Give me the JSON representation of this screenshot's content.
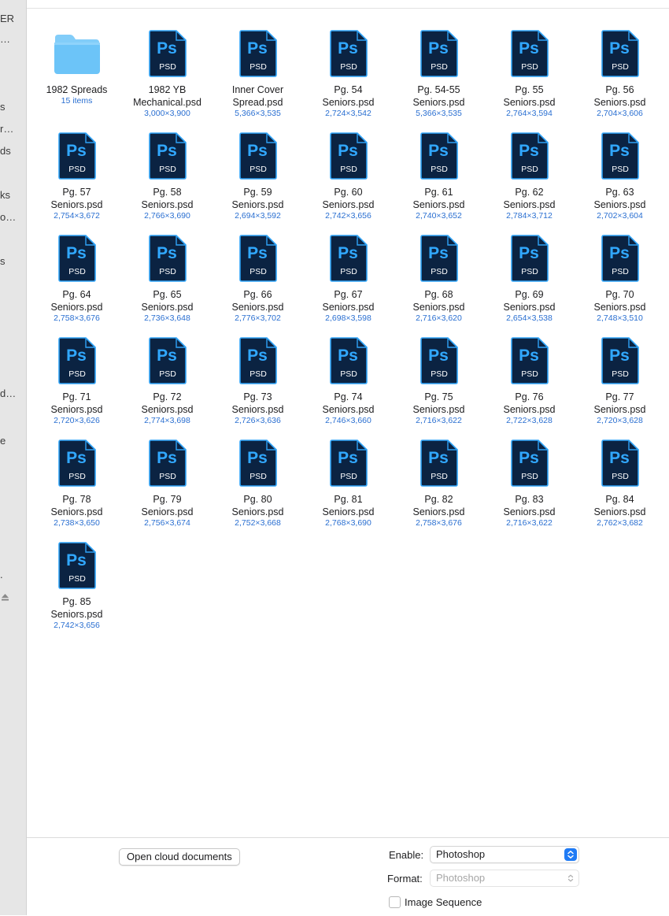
{
  "sidebar": {
    "fragments": [
      "ER",
      "…",
      "s",
      "r…",
      "ds",
      "ks",
      "o…",
      "s",
      "d…",
      "e",
      "."
    ]
  },
  "icons": {
    "psd_glyph": "Ps",
    "psd_ext": "PSD",
    "psd_bg": "#0b2342",
    "psd_border": "#2fa3f7",
    "psd_text": "#31a8ff",
    "folder_color": "#6cc4f8"
  },
  "files": [
    {
      "line1": "1982 Spreads",
      "line2": "",
      "sub": "15 items",
      "type": "folder"
    },
    {
      "line1": "1982 YB",
      "line2": "Mechanical.psd",
      "sub": "3,000×3,900",
      "type": "psd"
    },
    {
      "line1": "Inner Cover",
      "line2": "Spread.psd",
      "sub": "5,366×3,535",
      "type": "psd"
    },
    {
      "line1": "Pg. 54",
      "line2": "Seniors.psd",
      "sub": "2,724×3,542",
      "type": "psd"
    },
    {
      "line1": "Pg. 54-55",
      "line2": "Seniors.psd",
      "sub": "5,366×3,535",
      "type": "psd"
    },
    {
      "line1": "Pg. 55",
      "line2": "Seniors.psd",
      "sub": "2,764×3,594",
      "type": "psd"
    },
    {
      "line1": "Pg. 56",
      "line2": "Seniors.psd",
      "sub": "2,704×3,606",
      "type": "psd"
    },
    {
      "line1": "Pg. 57",
      "line2": "Seniors.psd",
      "sub": "2,754×3,672",
      "type": "psd"
    },
    {
      "line1": "Pg. 58",
      "line2": "Seniors.psd",
      "sub": "2,766×3,690",
      "type": "psd"
    },
    {
      "line1": "Pg. 59",
      "line2": "Seniors.psd",
      "sub": "2,694×3,592",
      "type": "psd"
    },
    {
      "line1": "Pg. 60",
      "line2": "Seniors.psd",
      "sub": "2,742×3,656",
      "type": "psd"
    },
    {
      "line1": "Pg. 61",
      "line2": "Seniors.psd",
      "sub": "2,740×3,652",
      "type": "psd"
    },
    {
      "line1": "Pg. 62",
      "line2": "Seniors.psd",
      "sub": "2,784×3,712",
      "type": "psd"
    },
    {
      "line1": "Pg. 63",
      "line2": "Seniors.psd",
      "sub": "2,702×3,604",
      "type": "psd"
    },
    {
      "line1": "Pg. 64",
      "line2": "Seniors.psd",
      "sub": "2,758×3,676",
      "type": "psd"
    },
    {
      "line1": "Pg. 65",
      "line2": "Seniors.psd",
      "sub": "2,736×3,648",
      "type": "psd"
    },
    {
      "line1": "Pg. 66",
      "line2": "Seniors.psd",
      "sub": "2,776×3,702",
      "type": "psd"
    },
    {
      "line1": "Pg. 67",
      "line2": "Seniors.psd",
      "sub": "2,698×3,598",
      "type": "psd"
    },
    {
      "line1": "Pg. 68",
      "line2": "Seniors.psd",
      "sub": "2,716×3,620",
      "type": "psd"
    },
    {
      "line1": "Pg. 69",
      "line2": "Seniors.psd",
      "sub": "2,654×3,538",
      "type": "psd"
    },
    {
      "line1": "Pg. 70",
      "line2": "Seniors.psd",
      "sub": "2,748×3,510",
      "type": "psd"
    },
    {
      "line1": "Pg. 71",
      "line2": "Seniors.psd",
      "sub": "2,720×3,626",
      "type": "psd"
    },
    {
      "line1": "Pg. 72",
      "line2": "Seniors.psd",
      "sub": "2,774×3,698",
      "type": "psd"
    },
    {
      "line1": "Pg. 73",
      "line2": "Seniors.psd",
      "sub": "2,726×3,636",
      "type": "psd"
    },
    {
      "line1": "Pg. 74",
      "line2": "Seniors.psd",
      "sub": "2,746×3,660",
      "type": "psd"
    },
    {
      "line1": "Pg. 75",
      "line2": "Seniors.psd",
      "sub": "2,716×3,622",
      "type": "psd"
    },
    {
      "line1": "Pg. 76",
      "line2": "Seniors.psd",
      "sub": "2,722×3,628",
      "type": "psd"
    },
    {
      "line1": "Pg. 77",
      "line2": "Seniors.psd",
      "sub": "2,720×3,628",
      "type": "psd"
    },
    {
      "line1": "Pg. 78",
      "line2": "Seniors.psd",
      "sub": "2,738×3,650",
      "type": "psd"
    },
    {
      "line1": "Pg. 79",
      "line2": "Seniors.psd",
      "sub": "2,756×3,674",
      "type": "psd"
    },
    {
      "line1": "Pg. 80",
      "line2": "Seniors.psd",
      "sub": "2,752×3,668",
      "type": "psd"
    },
    {
      "line1": "Pg. 81",
      "line2": "Seniors.psd",
      "sub": "2,768×3,690",
      "type": "psd"
    },
    {
      "line1": "Pg. 82",
      "line2": "Seniors.psd",
      "sub": "2,758×3,676",
      "type": "psd"
    },
    {
      "line1": "Pg. 83",
      "line2": "Seniors.psd",
      "sub": "2,716×3,622",
      "type": "psd"
    },
    {
      "line1": "Pg. 84",
      "line2": "Seniors.psd",
      "sub": "2,762×3,682",
      "type": "psd"
    },
    {
      "line1": "Pg. 85",
      "line2": "Seniors.psd",
      "sub": "2,742×3,656",
      "type": "psd"
    }
  ],
  "bottom": {
    "cloud_button": "Open cloud documents",
    "enable_label": "Enable:",
    "enable_value": "Photoshop",
    "format_label": "Format:",
    "format_value": "Photoshop",
    "image_sequence_label": "Image Sequence",
    "image_sequence_checked": false,
    "accent": "#1f7bf5"
  }
}
